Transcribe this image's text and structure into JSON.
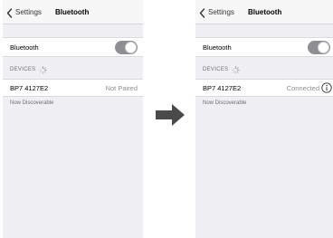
{
  "screens": [
    {
      "nav": {
        "back_label": "Settings",
        "title": "Bluetooth"
      },
      "bluetooth_toggle": {
        "label": "Bluetooth",
        "state": "on"
      },
      "devices_section": {
        "header": "DEVICES"
      },
      "device": {
        "name": "BP7 4127E2",
        "status": "Not Paired"
      },
      "footer": "Now Discoverable"
    },
    {
      "nav": {
        "back_label": "Settings",
        "title": "Bluetooth"
      },
      "bluetooth_toggle": {
        "label": "Bluetooth",
        "state": "on"
      },
      "devices_section": {
        "header": "DEVICES"
      },
      "device": {
        "name": "BP7 4127E2",
        "status": "Connected",
        "info_icon": "info-icon"
      },
      "footer": "Now Discoverable"
    }
  ],
  "transition_icon": "right-arrow-icon",
  "colors": {
    "screen_background": "#efeff4",
    "toggle_on": "#8e8e93",
    "secondary_text": "#8e8e93",
    "arrow": "#4a4a4a"
  }
}
